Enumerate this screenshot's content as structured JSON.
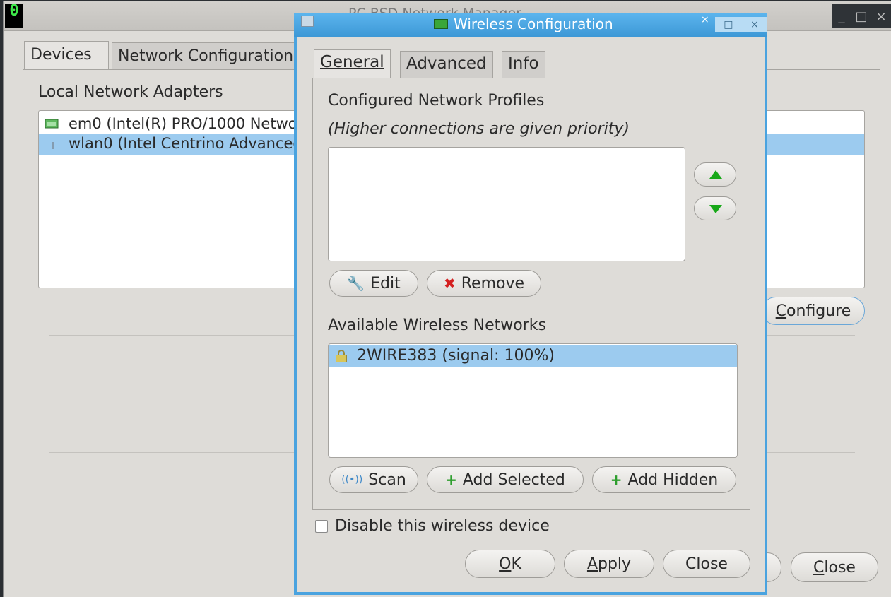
{
  "background_window": {
    "title": "PC-BSD Network Manager",
    "app_icon_glyph": "0",
    "wm_buttons": [
      "_",
      "□",
      "×"
    ],
    "tabs": [
      "Devices",
      "Network Configuration"
    ],
    "section_label": "Local Network Adapters",
    "adapters": [
      {
        "label": "em0 (Intel(R) PRO/1000 Network Connection)",
        "icon": "wired-network-icon",
        "selected": false
      },
      {
        "label": "wlan0 (Intel Centrino Advanced-N 6205)",
        "icon": "wireless-network-icon",
        "selected": true
      }
    ],
    "configure_label": "Configure",
    "close_label": "Close"
  },
  "dialog": {
    "title": "Wireless Configuration",
    "wm_buttons": [
      "□",
      "×"
    ],
    "pin_glyph": "×",
    "tabs": [
      {
        "label": "General",
        "active": true
      },
      {
        "label": "Advanced",
        "active": false
      },
      {
        "label": "Info",
        "active": false
      }
    ],
    "profiles_label": "Configured Network Profiles",
    "priority_note": "(Higher connections are given priority)",
    "profiles": [],
    "edit_label": "Edit",
    "remove_label": "Remove",
    "available_label": "Available Wireless Networks",
    "networks": [
      {
        "label": "2WIRE383 (signal: 100%)",
        "secured": true,
        "selected": true
      }
    ],
    "scan_label": "Scan",
    "add_selected_label": "Add Selected",
    "add_hidden_label": "Add Hidden",
    "disable_label": "Disable this wireless device",
    "disable_checked": false,
    "ok_label": "OK",
    "apply_label": "Apply",
    "close_label": "Close"
  },
  "colors": {
    "accent": "#4aa3df",
    "selection": "#9ccbef",
    "arrow_green": "#18a818",
    "remove_red": "#d42020"
  }
}
